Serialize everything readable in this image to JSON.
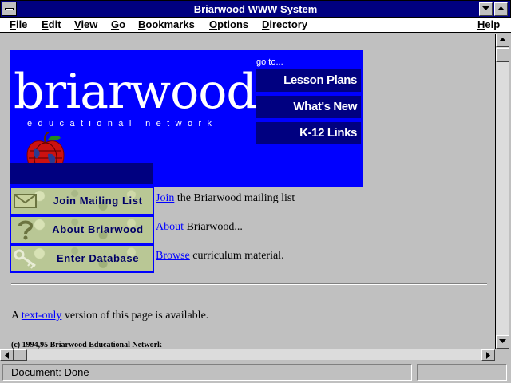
{
  "window": {
    "title": "Briarwood WWW System"
  },
  "menubar": {
    "items": [
      "File",
      "Edit",
      "View",
      "Go",
      "Bookmarks",
      "Options",
      "Directory"
    ],
    "help": "Help"
  },
  "banner": {
    "logo_word": "briarwood",
    "logo_sub": "educational network",
    "goto_label": "go to...",
    "nav": [
      "Lesson Plans",
      "What's New",
      "K-12 Links"
    ]
  },
  "buttons": [
    {
      "label": "Join Mailing List",
      "icon": "envelope-icon"
    },
    {
      "label": "About Briarwood",
      "icon": "question-mark-icon"
    },
    {
      "label": "Enter Database",
      "icon": "key-icon"
    }
  ],
  "lines": [
    {
      "link": "Join",
      "rest": " the Briarwood mailing list"
    },
    {
      "link": "About",
      "rest": " Briarwood..."
    },
    {
      "link": "Browse",
      "rest": " curriculum material."
    }
  ],
  "textonly": {
    "before": "A ",
    "link": "text-only",
    "after": " version of this page is available."
  },
  "copyright": "(c) 1994,95 Briarwood Educational Network",
  "status": {
    "text": "Document: Done"
  },
  "colors": {
    "titlebar": "#000080",
    "banner": "#0000ff",
    "nav_button": "#000080",
    "link": "#0000ff"
  }
}
